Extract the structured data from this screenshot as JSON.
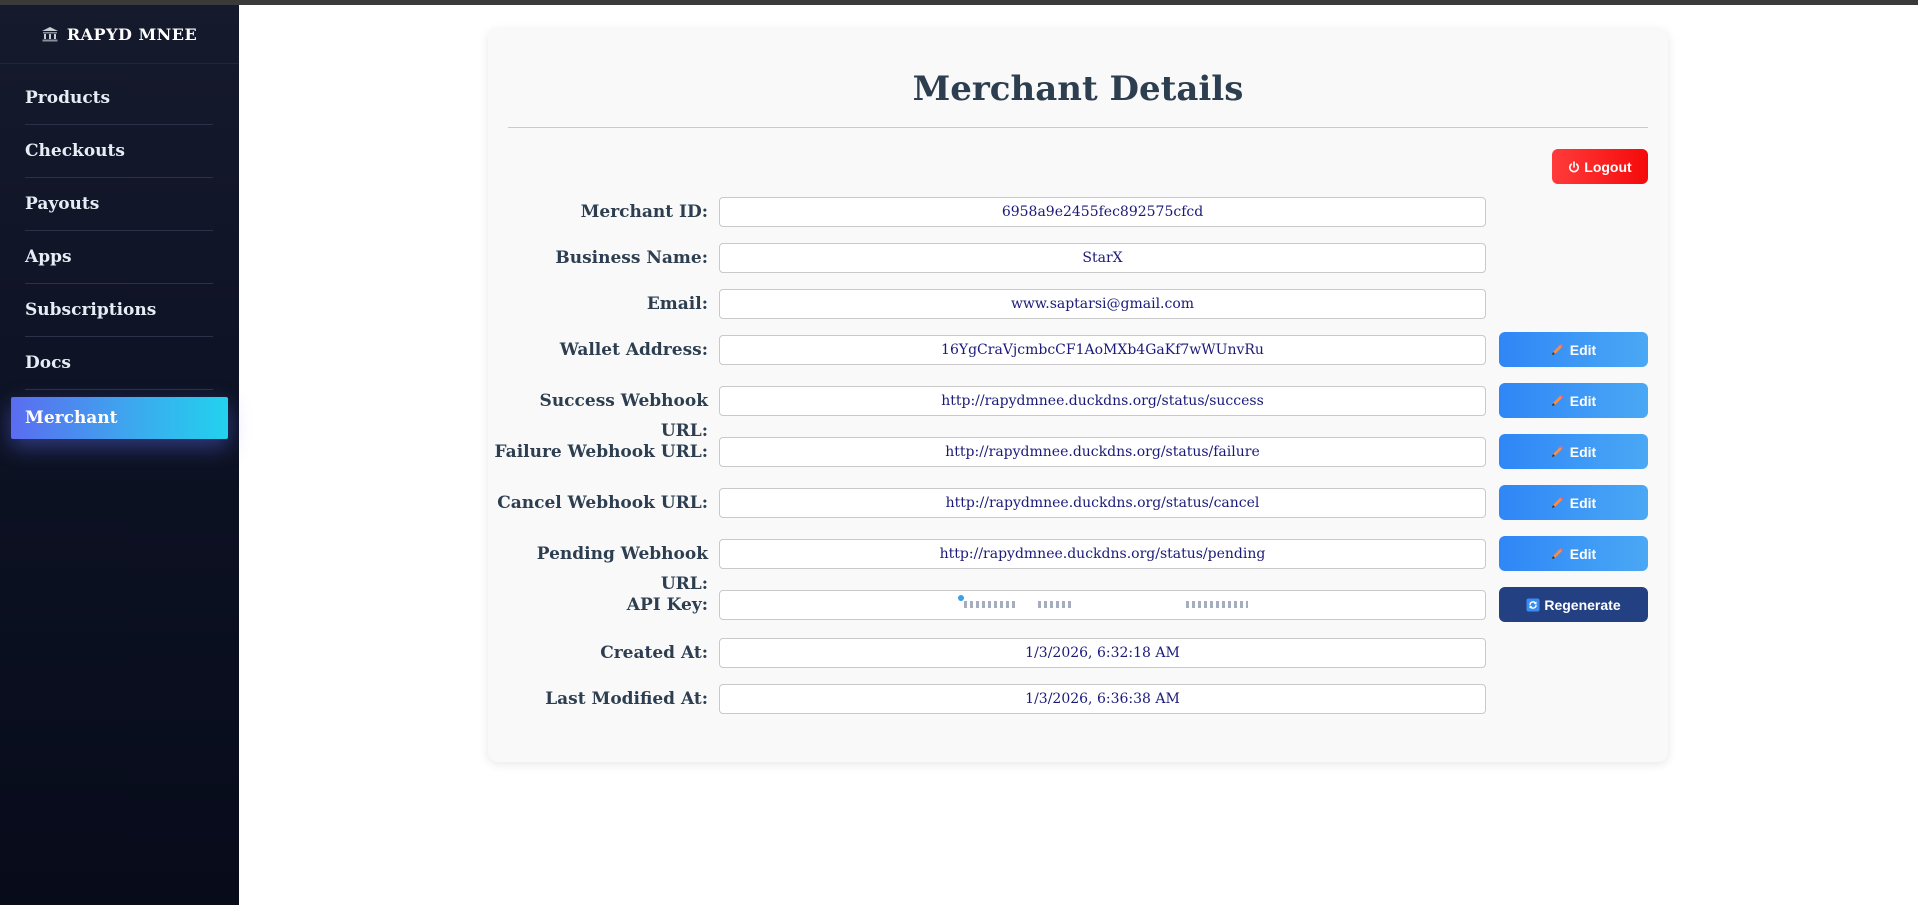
{
  "brand": {
    "title": "RAPYD MNEE",
    "icon": "bank-icon"
  },
  "sidebar": {
    "items": [
      {
        "label": "Products",
        "active": false
      },
      {
        "label": "Checkouts",
        "active": false
      },
      {
        "label": "Payouts",
        "active": false
      },
      {
        "label": "Apps",
        "active": false
      },
      {
        "label": "Subscriptions",
        "active": false
      },
      {
        "label": "Docs",
        "active": false
      },
      {
        "label": "Merchant",
        "active": true
      }
    ]
  },
  "card": {
    "title": "Merchant Details",
    "logout_label": "Logout",
    "logout_icon": "power-icon",
    "edit_label": "Edit",
    "edit_icon": "pencil-icon",
    "regenerate_label": "Regenerate",
    "regenerate_icon": "refresh-icon"
  },
  "fields": {
    "merchant_id": {
      "label": "Merchant ID:",
      "value": "6958a9e2455fec892575cfcd"
    },
    "business_name": {
      "label": "Business Name:",
      "value": "StarX"
    },
    "email": {
      "label": "Email:",
      "value": "www.saptarsi@gmail.com"
    },
    "wallet_address": {
      "label": "Wallet Address:",
      "value": "16YgCraVjcmbcCF1AoMXb4GaKf7wWUnvRu"
    },
    "success_webhook": {
      "label": "Success Webhook URL:",
      "value": "http://rapydmnee.duckdns.org/status/success"
    },
    "failure_webhook": {
      "label": "Failure Webhook URL:",
      "value": "http://rapydmnee.duckdns.org/status/failure"
    },
    "cancel_webhook": {
      "label": "Cancel Webhook URL:",
      "value": "http://rapydmnee.duckdns.org/status/cancel"
    },
    "pending_webhook": {
      "label": "Pending Webhook URL:",
      "value": "http://rapydmnee.duckdns.org/status/pending"
    },
    "api_key": {
      "label": "API Key:",
      "value": ""
    },
    "created_at": {
      "label": "Created At:",
      "value": "1/3/2026, 6:32:18 AM"
    },
    "last_modified_at": {
      "label": "Last Modified At:",
      "value": "1/3/2026, 6:36:38 AM"
    }
  },
  "colors": {
    "sidebar_bg": "#0e1325",
    "active_gradient_start": "#5b6cf0",
    "active_gradient_end": "#22d2ee",
    "title_text": "#2c3e50",
    "field_text": "#1a1a7a",
    "logout_bg": "#f50a0a",
    "edit_bg": "#2f86f6",
    "regenerate_bg": "#234082"
  }
}
